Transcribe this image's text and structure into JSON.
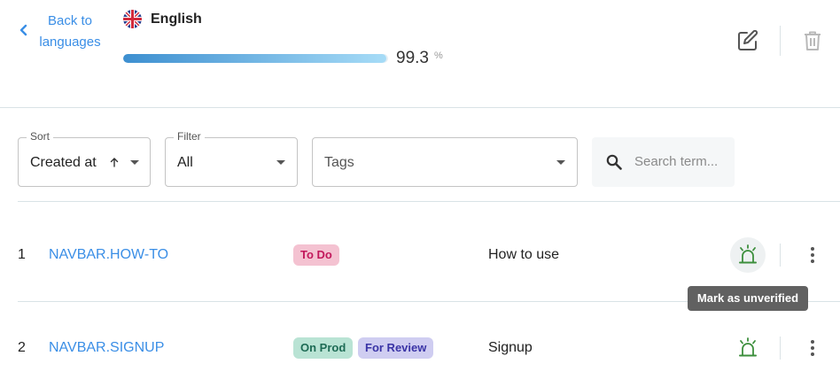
{
  "header": {
    "back_label": "Back to languages",
    "language_name": "English",
    "progress_percent": 99.3,
    "progress_value": "99.3",
    "progress_unit": "%",
    "edit_icon": "edit-icon",
    "delete_icon": "trash-icon"
  },
  "toolbar": {
    "sort": {
      "label": "Sort",
      "value": "Created at",
      "direction": "ascending"
    },
    "filter": {
      "label": "Filter",
      "value": "All"
    },
    "tags": {
      "placeholder": "Tags"
    },
    "search": {
      "placeholder": "Search term..."
    }
  },
  "rows": [
    {
      "index": "1",
      "key": "NAVBAR.HOW-TO",
      "tags": [
        "To Do"
      ],
      "text": "How to use"
    },
    {
      "index": "2",
      "key": "NAVBAR.SIGNUP",
      "tags": [
        "On Prod",
        "For Review"
      ],
      "text": "Signup"
    }
  ],
  "tooltip": {
    "text": "Mark as unverified"
  },
  "colors": {
    "accent": "#3a8ee6",
    "verified_green": "#3d8f3d",
    "tag_todo": "#f4c2d1",
    "tag_onprod": "#b9e3d4",
    "tag_review": "#cfcdf1"
  }
}
